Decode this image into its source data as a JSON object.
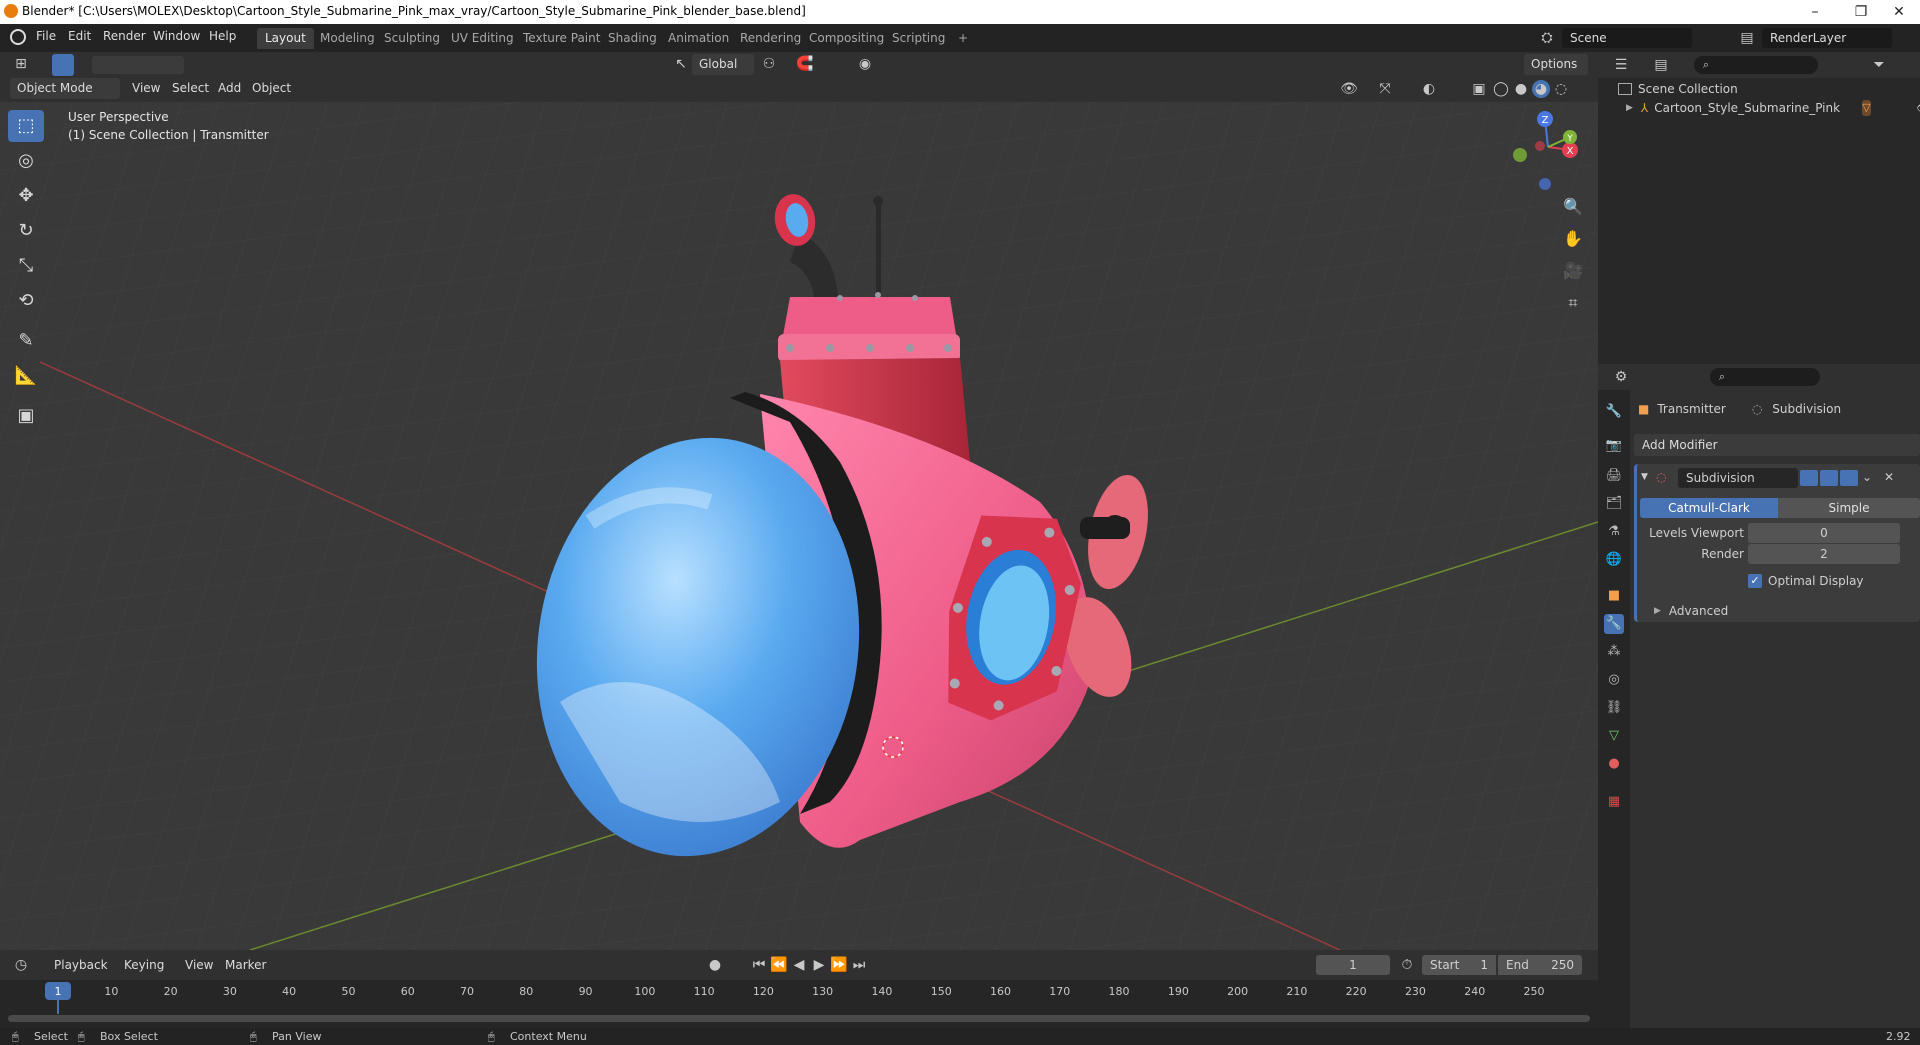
{
  "window": {
    "title": "Blender* [C:\\Users\\MOLEX\\Desktop\\Cartoon_Style_Submarine_Pink_max_vray/Cartoon_Style_Submarine_Pink_blender_base.blend]",
    "minimize": "–",
    "restore": "❐",
    "close": "✕"
  },
  "menu": [
    "File",
    "Edit",
    "Render",
    "Window",
    "Help"
  ],
  "workspaces": [
    "Layout",
    "Modeling",
    "Sculpting",
    "UV Editing",
    "Texture Paint",
    "Shading",
    "Animation",
    "Rendering",
    "Compositing",
    "Scripting",
    "+"
  ],
  "active_workspace": "Layout",
  "scene": {
    "name": "Scene",
    "render_layer": "RenderLayer"
  },
  "viewport_header": {
    "orientation": "Global",
    "options": "Options",
    "mode": "Object Mode",
    "menus": [
      "View",
      "Select",
      "Add",
      "Object"
    ]
  },
  "viewport": {
    "perspective": "User Perspective",
    "context": "(1) Scene Collection | Transmitter",
    "gizmo": {
      "z": "Z",
      "y": "Y",
      "x": "X"
    }
  },
  "tools": [
    {
      "name": "select-box",
      "glyph": "⬚"
    },
    {
      "name": "cursor",
      "glyph": "◎"
    },
    {
      "name": "move",
      "glyph": "✥"
    },
    {
      "name": "rotate",
      "glyph": "↻"
    },
    {
      "name": "scale",
      "glyph": "⤡"
    },
    {
      "name": "transform",
      "glyph": "⟲"
    },
    {
      "name": "annotate",
      "glyph": "✎"
    },
    {
      "name": "measure",
      "glyph": "📐"
    },
    {
      "name": "add-cube",
      "glyph": "▣"
    }
  ],
  "outliner": {
    "root": "Scene Collection",
    "items": [
      {
        "label": "Cartoon_Style_Submarine_Pink"
      }
    ]
  },
  "properties": {
    "object_name": "Transmitter",
    "modifier_tab_label": "Subdivision",
    "add_modifier": "Add Modifier",
    "modifier": {
      "name": "Subdivision",
      "types": [
        "Catmull-Clark",
        "Simple"
      ],
      "active_type": "Catmull-Clark",
      "levels_viewport_label": "Levels Viewport",
      "levels_viewport": "0",
      "render_label": "Render",
      "render": "2",
      "optimal_display_label": "Optimal Display",
      "optimal_display": true,
      "advanced": "Advanced"
    }
  },
  "timeline": {
    "menus": [
      "Playback",
      "Keying",
      "View",
      "Marker"
    ],
    "current_frame": "1",
    "start_label": "Start",
    "start": "1",
    "end_label": "End",
    "end": "250",
    "ticks": [
      "1",
      "10",
      "20",
      "30",
      "40",
      "50",
      "60",
      "70",
      "80",
      "90",
      "100",
      "110",
      "120",
      "130",
      "140",
      "150",
      "160",
      "170",
      "180",
      "190",
      "200",
      "210",
      "220",
      "230",
      "240",
      "250"
    ]
  },
  "status": {
    "select": "Select",
    "box_select": "Box Select",
    "pan_view": "Pan View",
    "context_menu": "Context Menu",
    "version": "2.92"
  },
  "colors": {
    "accent": "#4772b3",
    "sub_pink": "#ee5c88",
    "sub_red": "#d8344e",
    "glass_blue": "#5aaaf0"
  }
}
